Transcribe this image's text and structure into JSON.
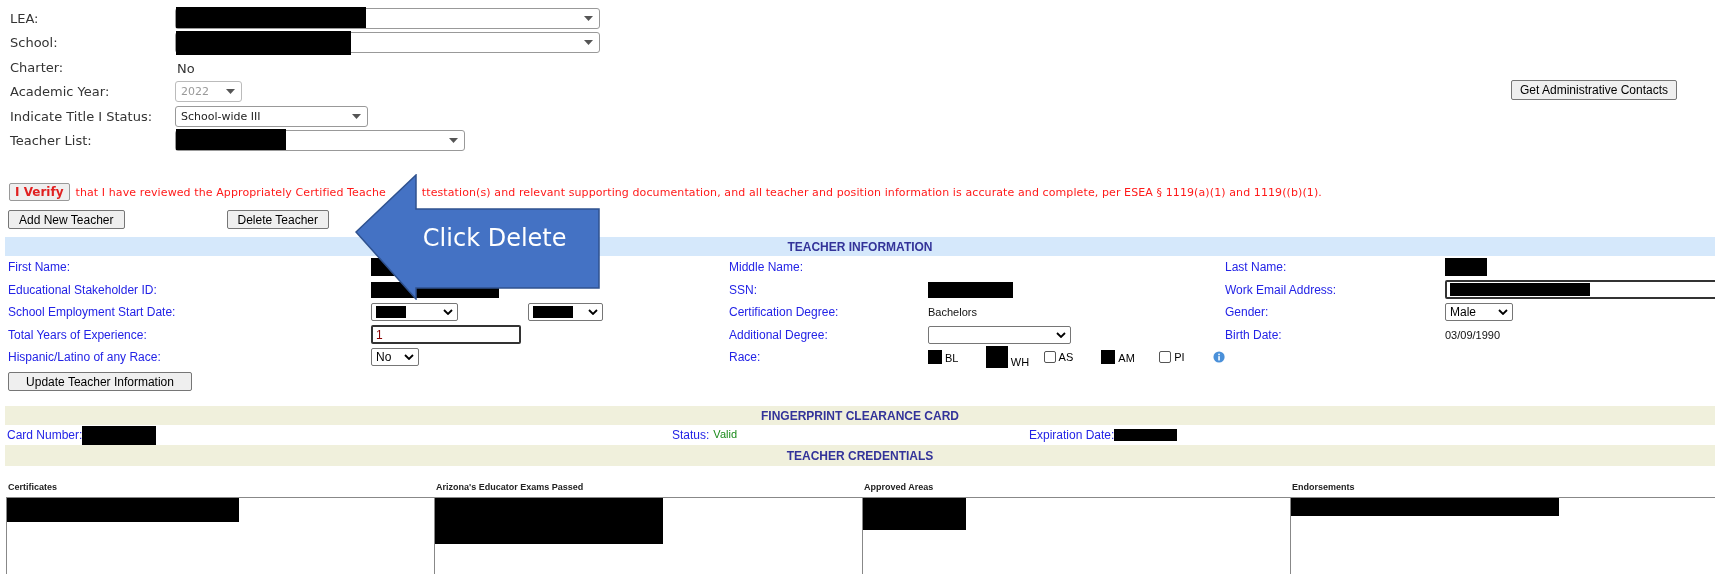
{
  "filters": [
    {
      "label": "LEA:",
      "kind": "select",
      "redacted": true
    },
    {
      "label": "School:",
      "kind": "select",
      "redacted": true
    },
    {
      "label": "Charter:",
      "kind": "text",
      "value": "No"
    },
    {
      "label": "Academic Year:",
      "kind": "select",
      "value": "2022",
      "disabled": true
    },
    {
      "label": "Indicate Title I Status:",
      "kind": "select",
      "value": "School-wide III"
    },
    {
      "label": "Teacher List:",
      "kind": "select",
      "redacted": true
    }
  ],
  "admin_button": "Get Administrative Contacts",
  "verify": {
    "button": "I Verify",
    "text_before": "that I have reviewed the Appropriately Certified Teache",
    "text_after": "ttestation(s) and relevant supporting documentation, and all teacher and position information is accurate and complete, per ESEA § 1119(a)(1) and 1119((b)(1)."
  },
  "actions": [
    "Add New Teacher",
    "Delete Teacher"
  ],
  "callout": {
    "text": "Click Delete"
  },
  "teacher_information": {
    "title": "TEACHER INFORMATION",
    "rows": [
      [
        {
          "label": "First Name:",
          "kind": "redacted"
        },
        {
          "label": "Middle Name:",
          "kind": "empty"
        },
        {
          "label": "Last Name:",
          "kind": "redacted"
        }
      ],
      [
        {
          "label": "Educational Stakeholder ID:",
          "kind": "redacted-long"
        },
        {
          "label": "SSN:",
          "kind": "redacted-long"
        },
        {
          "label": "Work Email Address:",
          "kind": "input-redacted"
        }
      ],
      [
        {
          "label": "School Employment Start Date:",
          "kind": "date-selects"
        },
        {
          "label": "Certification Degree:",
          "kind": "text",
          "value": "Bachelors"
        },
        {
          "label": "Gender:",
          "kind": "select",
          "value": "Male"
        }
      ],
      [
        {
          "label": "Total Years of Experience:",
          "kind": "input",
          "value": "1"
        },
        {
          "label": "Additional Degree:",
          "kind": "select-wide"
        },
        {
          "label": "Birth Date:",
          "kind": "text",
          "value": "03/09/1990"
        }
      ],
      [
        {
          "label": "Hispanic/Latino of any Race:",
          "kind": "select",
          "value": "No"
        },
        {
          "label": "Race:",
          "kind": "race"
        }
      ]
    ],
    "race_options": [
      {
        "label": "BL",
        "redacted": true
      },
      {
        "label": "WH",
        "redacted": true
      },
      {
        "label": "AS",
        "checked": false,
        "redacted": false
      },
      {
        "label": "AM",
        "redacted": true
      },
      {
        "label": "PI",
        "checked": false,
        "redacted": false
      }
    ],
    "update_button": "Update Teacher Information"
  },
  "fingerprint": {
    "title": "FINGERPRINT CLEARANCE CARD",
    "card_label": "Card Number:",
    "status_label": "Status:",
    "status": "Valid",
    "expiration_label": "Expiration Date:"
  },
  "credentials": {
    "title": "TEACHER CREDENTIALS",
    "columns": [
      "Certificates",
      "Arizona's Educator Exams Passed",
      "Approved Areas",
      "Endorsements"
    ]
  }
}
